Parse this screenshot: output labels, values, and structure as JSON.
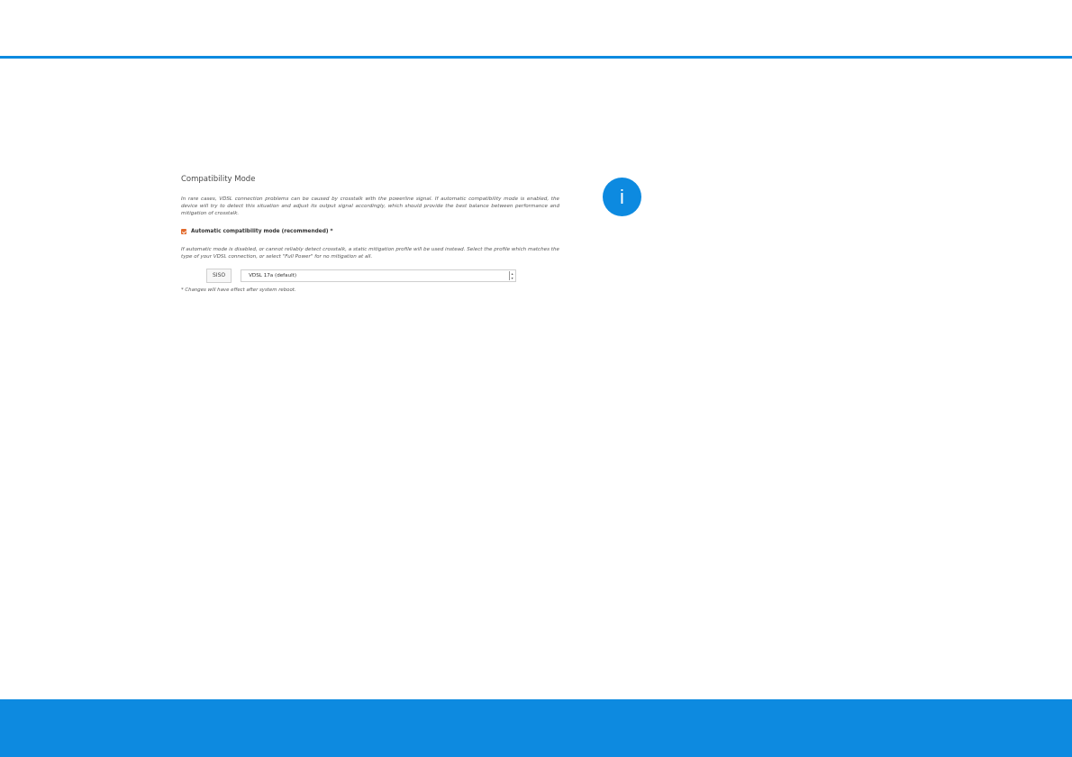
{
  "section": {
    "title": "Compatibility Mode",
    "description": "In rare cases, VDSL connection problems can be caused by crosstalk with the powerline signal. If automatic compatibility mode is enabled, the device will try to detect this situation and adjust its output signal accordingly, which should provide the best balance between performance and mitigation of crosstalk.",
    "checkbox_label": "Automatic compatibility mode (recommended) *",
    "checkbox_checked": true,
    "description2": "If automatic mode is disabled, or cannot reliably detect crosstalk, a static mitigation profile will be used instead. Select the profile which matches the type of your VDSL connection, or select \"Full Power\" for no mitigation at all.",
    "tag": "SISO",
    "select_value": "VDSL 17a (default)",
    "footnote": "* Changes will have effect after system reboot."
  },
  "info_icon": {
    "glyph": "i",
    "color": "#0d8ae0"
  },
  "colors": {
    "accent": "#0d8ae0",
    "checkbox": "#e26a2c"
  }
}
